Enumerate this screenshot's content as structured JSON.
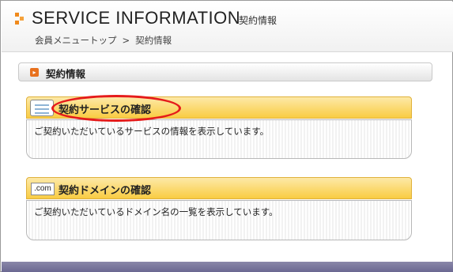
{
  "header": {
    "title": "SERVICE INFORMATION",
    "subtitle": "契約情報",
    "breadcrumb": {
      "home": "会員メニュートップ",
      "separator": ">",
      "current": "契約情報"
    }
  },
  "section": {
    "title": "契約情報",
    "icon": "orange-arrow-icon"
  },
  "cards": [
    {
      "title": "契約サービスの確認",
      "description": "ご契約いただいているサービスの情報を表示しています。",
      "icon": "document-icon",
      "highlighted": true
    },
    {
      "title": "契約ドメインの確認",
      "description": "ご契約いただいているドメイン名の一覧を表示しています。",
      "icon_text": ".com",
      "icon": "dotcom-icon"
    }
  ],
  "colors": {
    "accent_orange": "#f08a1c",
    "card_header_yellow": "#f9cc42",
    "highlight_red": "#e51b1b",
    "footer_strip": "#6b6891"
  }
}
